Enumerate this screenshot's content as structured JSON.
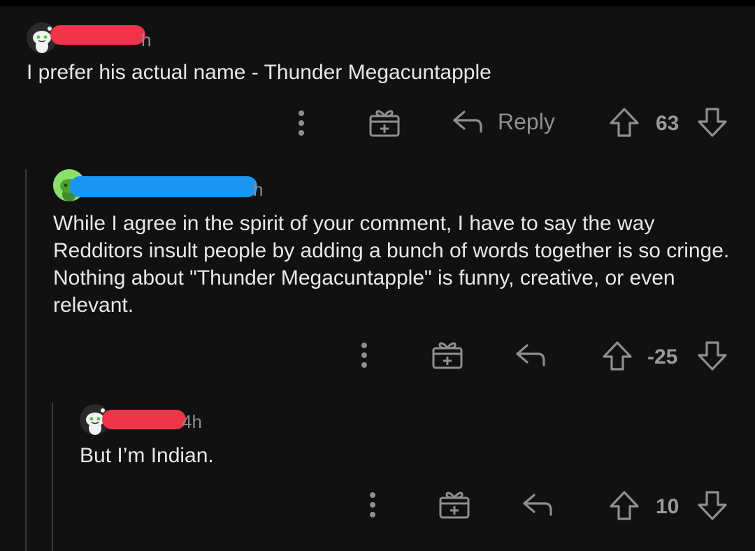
{
  "comments": [
    {
      "age": "h",
      "text": "I prefer his actual name - Thunder Megacuntapple",
      "reply_label": "Reply",
      "score": "63",
      "colors": {
        "redaction": "#f0344a",
        "avatar_bg": "#2a2a2a"
      }
    },
    {
      "age": "h",
      "text": "While I agree in the spirit of your comment, I have to say the way Redditors insult people by adding a bunch of words together is so cringe. Nothing about \"Thunder Megacuntapple\" is funny, creative, or even relevant.",
      "score": "-25",
      "colors": {
        "redaction": "#1a95f2",
        "avatar_bg": "#8be06a"
      }
    },
    {
      "age": "4h",
      "text": "But I’m Indian.",
      "score": "10",
      "colors": {
        "redaction": "#f0344a",
        "avatar_bg": "#2a2a2a"
      }
    }
  ],
  "icons": [
    "more-options-icon",
    "award-icon",
    "reply-icon",
    "upvote-icon",
    "downvote-icon"
  ]
}
